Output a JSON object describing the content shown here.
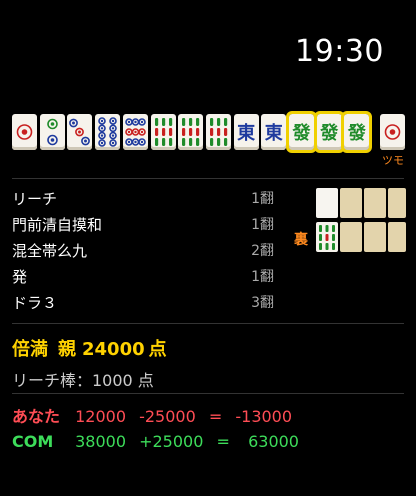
{
  "clock": "19:30",
  "hand": {
    "tiles": [
      {
        "name": "pin-1",
        "kind": "pin",
        "count": 1
      },
      {
        "name": "pin-2",
        "kind": "pin",
        "count": 2
      },
      {
        "name": "pin-3",
        "kind": "pin",
        "count": 3
      },
      {
        "name": "pin-8",
        "kind": "pin",
        "count": 8
      },
      {
        "name": "pin-9",
        "kind": "pin",
        "count": 9
      },
      {
        "name": "sou-9",
        "kind": "sou",
        "count": 9
      },
      {
        "name": "sou-9",
        "kind": "sou",
        "count": 9
      },
      {
        "name": "sou-9",
        "kind": "sou",
        "count": 9
      },
      {
        "name": "east",
        "kind": "honor",
        "char": "東",
        "color": "#1e3a9e"
      },
      {
        "name": "east",
        "kind": "honor",
        "char": "東",
        "color": "#1e3a9e"
      },
      {
        "name": "green-dragon",
        "kind": "honor",
        "char": "發",
        "color": "#1f8b2a",
        "highlight": true
      },
      {
        "name": "green-dragon",
        "kind": "honor",
        "char": "發",
        "color": "#1f8b2a",
        "highlight": true
      },
      {
        "name": "green-dragon",
        "kind": "honor",
        "char": "發",
        "color": "#1f8b2a",
        "highlight": true
      }
    ],
    "winning_tile": {
      "name": "pin-1",
      "kind": "pin",
      "count": 1
    },
    "tsumo_label": "ツモ"
  },
  "yaku": [
    {
      "name": "リーチ",
      "han": "1翻"
    },
    {
      "name": "門前清自摸和",
      "han": "1翻"
    },
    {
      "name": "混全帯么九",
      "han": "2翻"
    },
    {
      "name": "発",
      "han": "1翻"
    },
    {
      "name": "ドラ３",
      "han": "3翻"
    }
  ],
  "ura_label": "裏",
  "score": {
    "rank": "倍満",
    "dealer": "親",
    "points": "24000",
    "unit": "点"
  },
  "riichi_stick": "リーチ棒：1000 点",
  "results": [
    {
      "who": "あなた",
      "before": "12000",
      "delta": "-25000",
      "eq": "=",
      "after": "-13000"
    },
    {
      "who": "COM",
      "before": "38000",
      "delta": "+25000",
      "eq": "=",
      "after": " 63000"
    }
  ],
  "colors": {
    "accent": "#ffd200",
    "orange": "#ff8a1f",
    "you": "#ff4d55",
    "com": "#3ddc5a"
  }
}
